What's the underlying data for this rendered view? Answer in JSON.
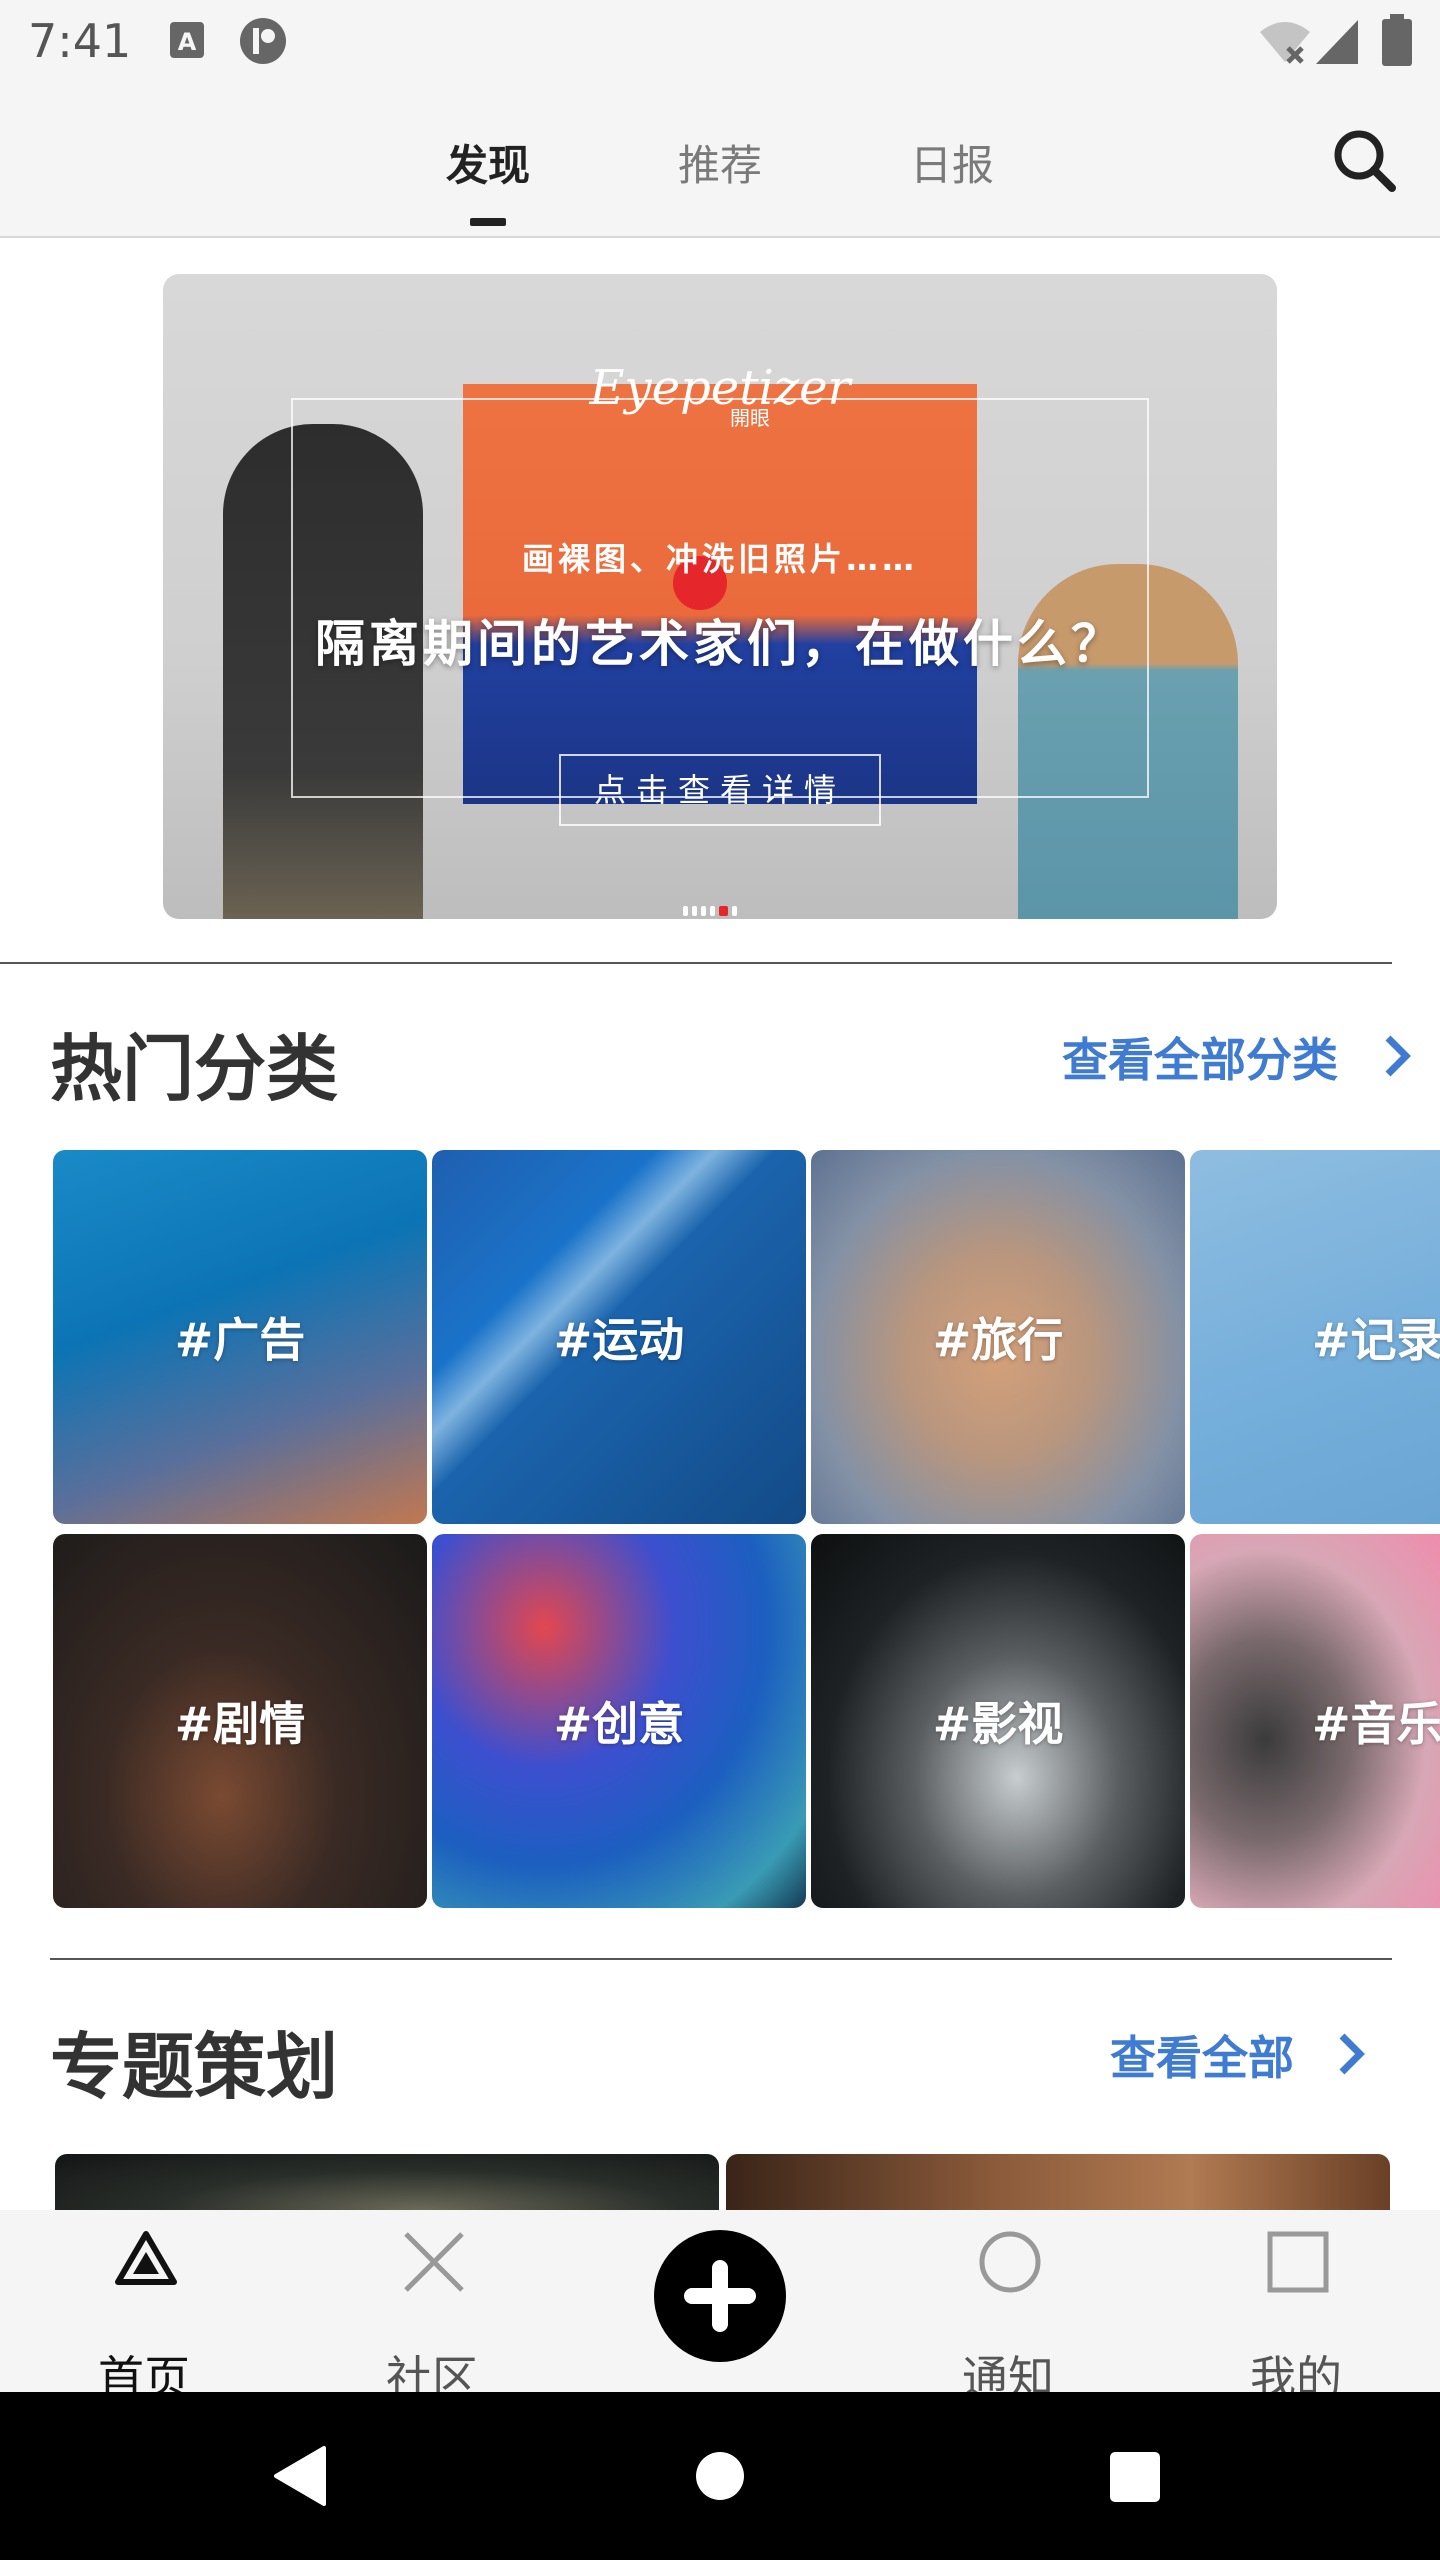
{
  "status_bar": {
    "time": "7:41"
  },
  "top_tabs": {
    "tabs": [
      {
        "label": "发现",
        "active": true
      },
      {
        "label": "推荐",
        "active": false
      },
      {
        "label": "日报",
        "active": false
      }
    ],
    "search_icon": "search-icon"
  },
  "banner": {
    "brand": "Eyepetizer",
    "brand_sub": "開眼",
    "subtitle": "画裸图、冲洗旧照片……",
    "title": "隔离期间的艺术家们，在做什么？",
    "cta": "点击查看详情",
    "page_count": 6,
    "active_page": 5
  },
  "hot_categories": {
    "title": "热门分类",
    "see_all": "查看全部分类",
    "items": [
      {
        "label": "#广告"
      },
      {
        "label": "#运动"
      },
      {
        "label": "#旅行"
      },
      {
        "label": "#记录"
      },
      {
        "label": "#剧情"
      },
      {
        "label": "#创意"
      },
      {
        "label": "#影视"
      },
      {
        "label": "#音乐"
      }
    ]
  },
  "special_topics": {
    "title": "专题策划",
    "see_all": "查看全部"
  },
  "bottom_nav": {
    "items": [
      {
        "label": "首页",
        "icon": "triangle-icon",
        "active": true
      },
      {
        "label": "社区",
        "icon": "cross-icon",
        "active": false
      },
      {
        "label": "",
        "icon": "plus-icon",
        "active": false
      },
      {
        "label": "通知",
        "icon": "circle-icon",
        "active": false
      },
      {
        "label": "我的",
        "icon": "square-icon",
        "active": false
      }
    ]
  },
  "colors": {
    "accent": "#3e7bd1",
    "banner_dot_active": "#e5262a"
  }
}
